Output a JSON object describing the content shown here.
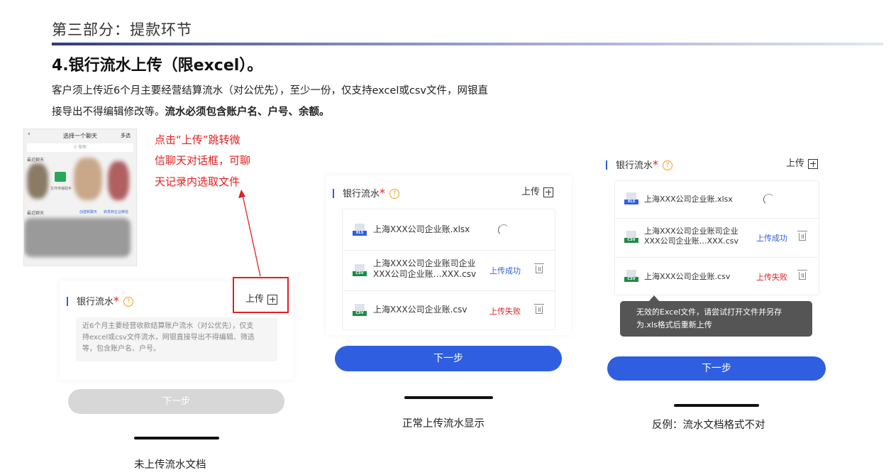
{
  "section_title": "第三部分：提款环节",
  "heading": "4.银行流水上传（限excel）。",
  "para_line1": "客户须上传近6个月主要经营结算流水（对公优先），至少一份，仅支持excel或csv文件，网银直",
  "para_line2_plain": "接导出不得编辑修改等。",
  "para_line2_bold": "流水必须包含账户名、户号、余额。",
  "thumb": {
    "title": "选择一个聊天",
    "more": "多选",
    "search": "搜索",
    "recent_chats": "最近聊天"
  },
  "annotation": [
    "点击“上传”跳转微",
    "信聊天对话框，可聊",
    "天记录内选取文件"
  ],
  "field": {
    "label": "银行流水",
    "required": "*",
    "help": "?",
    "upload": "上传"
  },
  "panel1": {
    "desc_lines": [
      "近6个月主要经营收款结算账户流水（对公优先），仅支",
      "持excel或csv文件流水，网银直接导出不得编辑、筛选",
      "等，包含账户名、户号。"
    ],
    "next": "下一步",
    "caption": "未上传流水文档"
  },
  "panel2": {
    "files": [
      {
        "icon": "XLS",
        "name1": "上海XXX公司企业账.xlsx",
        "name2": "",
        "status": ""
      },
      {
        "icon": "CSV",
        "name1": "上海XXX公司企业账司企业",
        "name2": "XXX公司企业账…XXX.csv",
        "status": "上传成功"
      },
      {
        "icon": "CSV",
        "name1": "上海XXX公司企业账.csv",
        "name2": "",
        "status": "上传失败"
      }
    ],
    "next": "下一步",
    "caption": "正常上传流水显示"
  },
  "panel3": {
    "files": [
      {
        "icon": "XLS",
        "name1": "上海XXX公司企业账.xlsx",
        "name2": "",
        "status": ""
      },
      {
        "icon": "CSV",
        "name1": "上海XXX公司企业账司企业",
        "name2": "XXX公司企业账…XXX.csv",
        "status": "上传成功"
      },
      {
        "icon": "CSV",
        "name1": "上海XXX公司企业账.csv",
        "name2": "",
        "status": "上传失败"
      }
    ],
    "tooltip_line1": "无效的Excel文件，请尝试打开文件并另存",
    "tooltip_line2": "为.xls格式后重新上传",
    "next": "下一步",
    "caption": "反例：流水文档格式不对"
  }
}
